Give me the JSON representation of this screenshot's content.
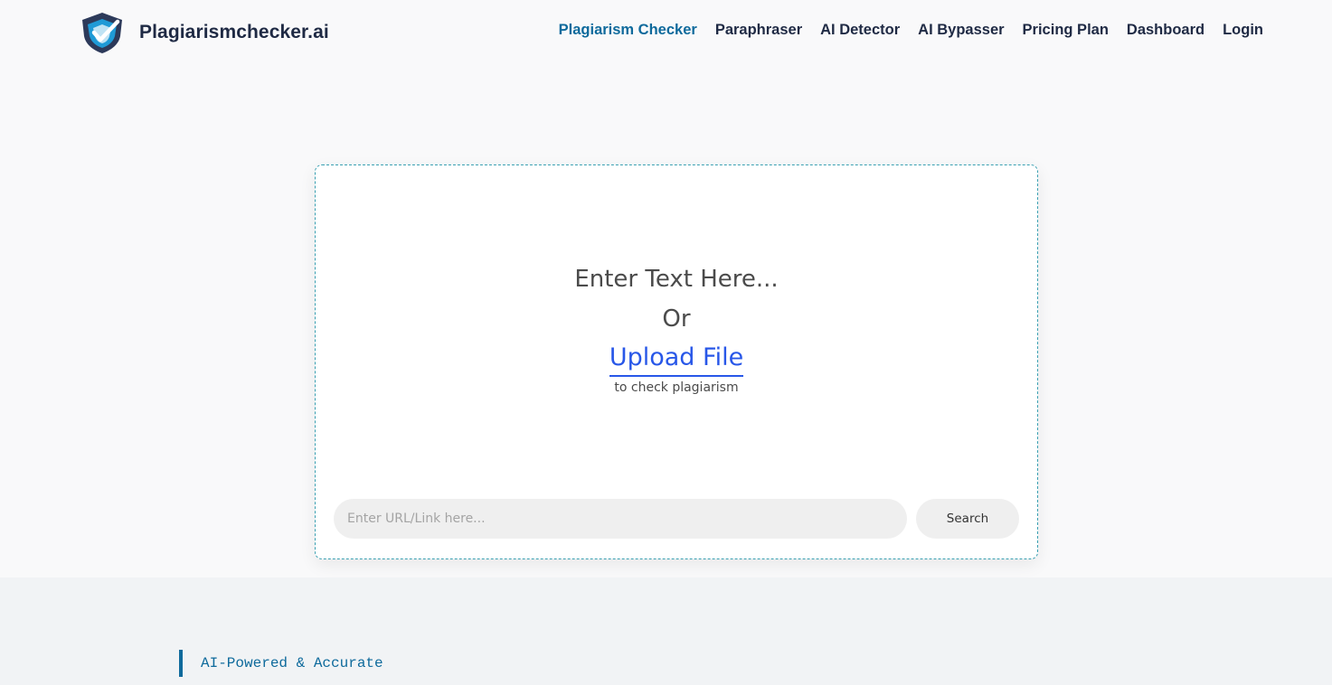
{
  "header": {
    "brand_name": "Plagiarismchecker.ai",
    "nav": [
      {
        "label": "Plagiarism Checker",
        "active": true
      },
      {
        "label": "Paraphraser"
      },
      {
        "label": "AI Detector"
      },
      {
        "label": "AI Bypasser"
      },
      {
        "label": "Pricing Plan"
      },
      {
        "label": "Dashboard"
      },
      {
        "label": "Login"
      }
    ]
  },
  "checker": {
    "prompt": "Enter Text Here...",
    "or": "Or",
    "upload_label": "Upload File",
    "sub": "to check plagiarism",
    "url_placeholder": "Enter URL/Link here...",
    "url_value": "",
    "search_label": "Search"
  },
  "features": {
    "tagline": "AI-Powered & Accurate"
  },
  "colors": {
    "accent": "#0e6a9c",
    "link": "#2857e8",
    "border": "#3aa0b2",
    "shield_dark": "#2d3a5a",
    "shield_light": "#1f9ad6"
  },
  "icons": {
    "logo": "shield-check-icon"
  }
}
